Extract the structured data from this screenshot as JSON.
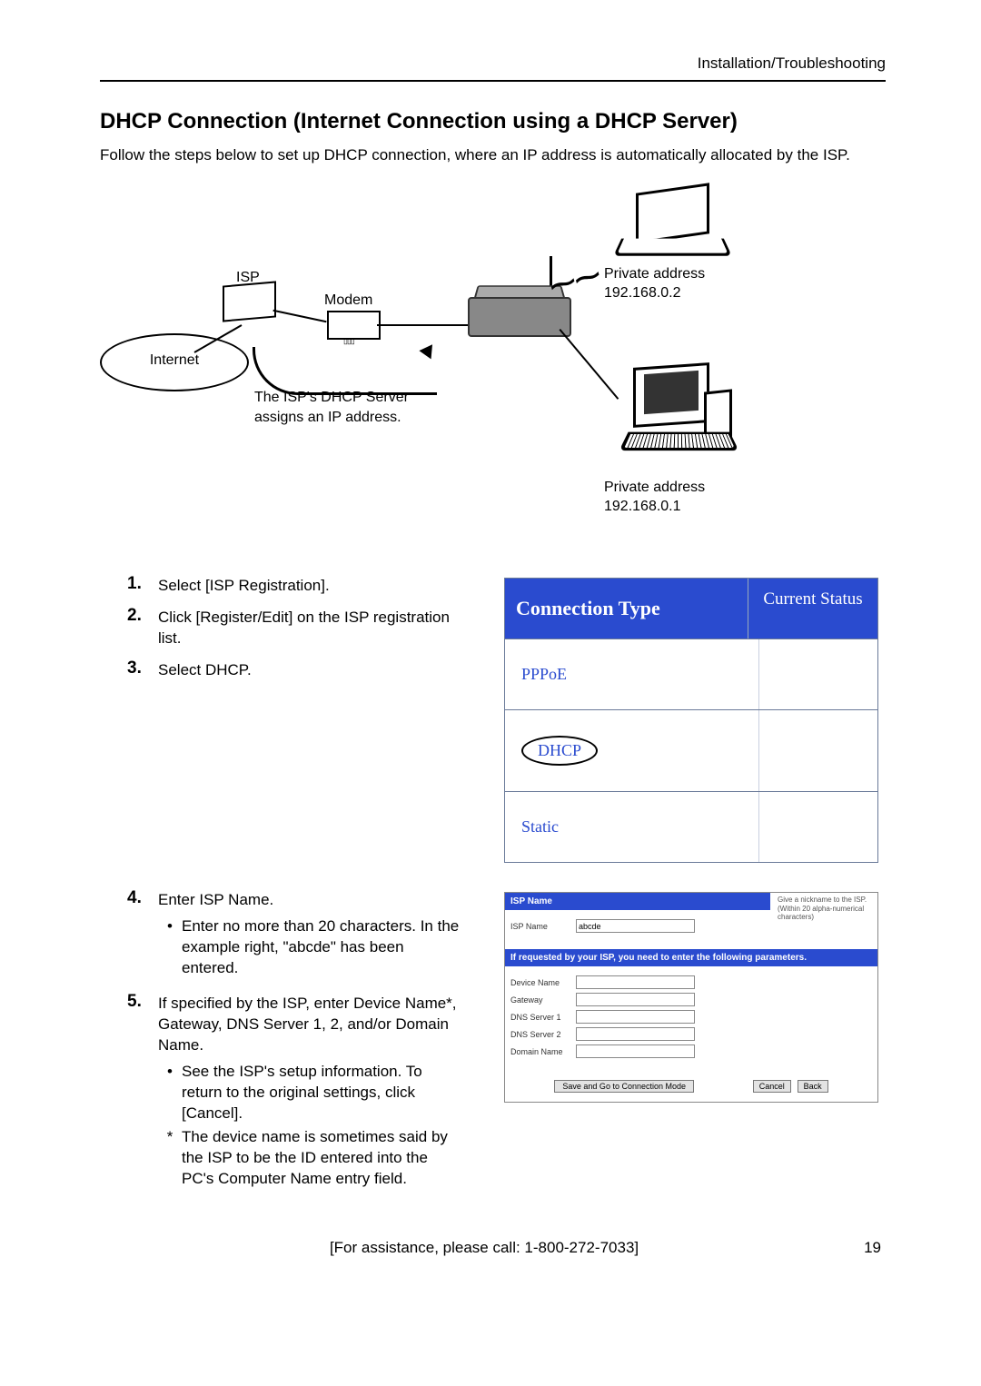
{
  "header": {
    "crumb": "Installation/Troubleshooting"
  },
  "title": "DHCP Connection (Internet Connection using a DHCP Server)",
  "intro": "Follow the steps below to set up DHCP connection, where an IP address is automatically allocated by the ISP.",
  "diagram": {
    "internet": "Internet",
    "isp": "ISP",
    "modem": "Modem",
    "server_line1": "The ISP's DHCP Server",
    "server_line2": "assigns an IP address.",
    "priv_laptop_l1": "Private address",
    "priv_laptop_l2": "192.168.0.2",
    "priv_pc_l1": "Private address",
    "priv_pc_l2": "192.168.0.1"
  },
  "steps": {
    "s1": "Select [ISP Registration].",
    "s2": "Click [Register/Edit] on the ISP registration list.",
    "s3": "Select DHCP.",
    "s4": "Enter ISP Name.",
    "s4_b1": "Enter no more than 20 characters. In the example right, \"abcde\" has been entered.",
    "s5": "If specified by the ISP, enter Device Name*, Gateway, DNS Server 1, 2, and/or Domain Name.",
    "s5_b1": "See the ISP's setup information. To return to the original settings, click [Cancel].",
    "s5_star": "The device name is sometimes said by the ISP to be the ID entered into the PC's Computer Name entry field."
  },
  "conn_table": {
    "h1": "Connection Type",
    "h2": "Current Status",
    "r1": "PPPoE",
    "r2": "DHCP",
    "r3": "Static"
  },
  "isp_form": {
    "hdr1": "ISP Name",
    "hint_l1": "Give a nickname to the ISP.",
    "hint_l2": "(Within 20 alpha-numerical",
    "hint_l3": "characters)",
    "lbl_isp": "ISP Name",
    "val_isp": "abcde",
    "hdr2": "If requested by your ISP, you need to enter the following parameters.",
    "lbl_dev": "Device Name",
    "lbl_gw": "Gateway",
    "lbl_d1": "DNS Server 1",
    "lbl_d2": "DNS Server 2",
    "lbl_dom": "Domain Name",
    "btn_save": "Save and Go to Connection Mode",
    "btn_cancel": "Cancel",
    "btn_back": "Back"
  },
  "footer": {
    "assist": "[For assistance, please call: 1-800-272-7033]",
    "page": "19"
  }
}
